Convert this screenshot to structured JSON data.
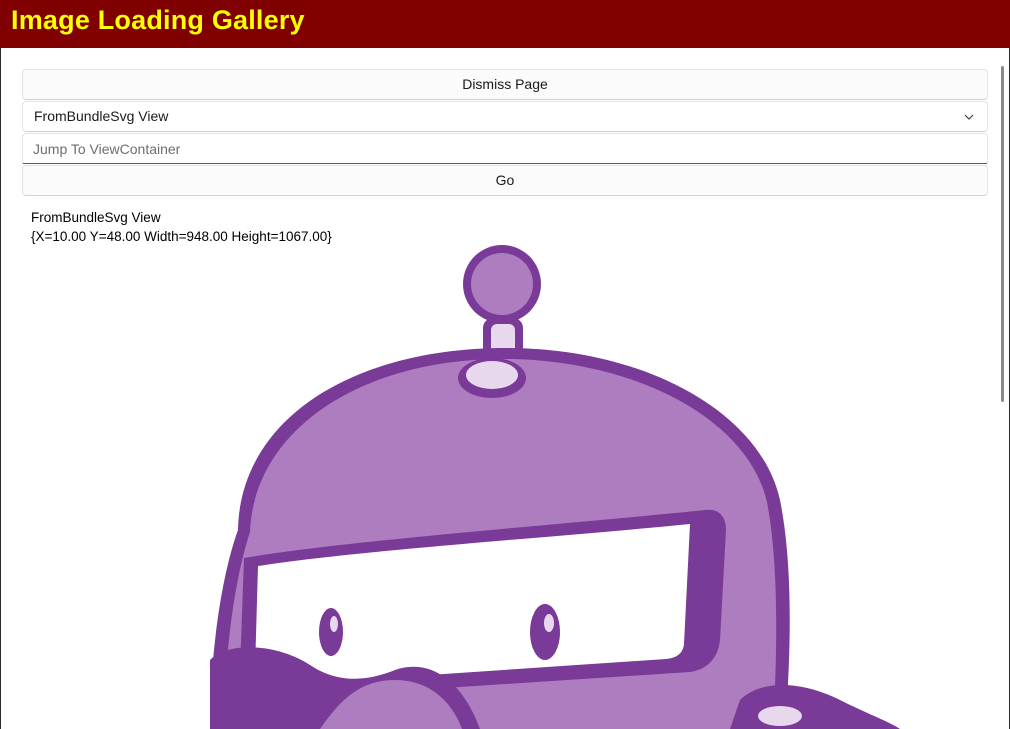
{
  "window": {
    "title": "Image Loading Gallery"
  },
  "controls": {
    "dismiss_label": "Dismiss Page",
    "view_select_value": "FromBundleSvg View",
    "jump_placeholder": "Jump To ViewContainer",
    "jump_value": "",
    "go_label": "Go"
  },
  "content": {
    "view_name": "FromBundleSvg View",
    "view_bounds": "{X=10.00 Y=48.00 Width=948.00 Height=1067.00}",
    "image_icon": "dotnet-bot-image"
  },
  "colors": {
    "titlebar_bg": "#800000",
    "titlebar_text": "#ffff00",
    "bot_dark": "#7a3a97",
    "bot_fill": "#ad7dbf",
    "bot_light": "#e8d8ee"
  }
}
